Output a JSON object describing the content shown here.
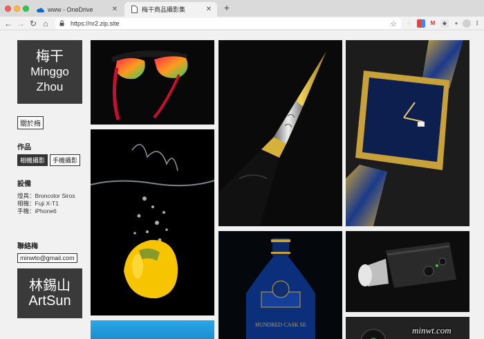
{
  "browser": {
    "tabs": [
      {
        "title": "www - OneDrive",
        "icon": "cloud-icon"
      },
      {
        "title": "梅干商品攝影集",
        "icon": "document-icon"
      }
    ],
    "url": "https://nr2.zip.site"
  },
  "sidebar": {
    "logo_line1": "梅干",
    "logo_line2": "Minggo",
    "logo_line3": "Zhou",
    "about_label": "關於梅",
    "works_title": "作品",
    "works_tabs": [
      "相機攝影",
      "手機攝影"
    ],
    "equipment_title": "設備",
    "equipment": [
      "燈具：Broncolor Siros",
      "相機：Fuji X-T1",
      "手機：iPhone6"
    ],
    "contact_title": "聯絡梅",
    "email": "minwto@gmail.com",
    "logo2_line1": "林錫山",
    "logo2_line2": "ArtSun"
  },
  "photos": {
    "bottle_label": "HUNDRED CASK SE"
  },
  "watermark": "minwt.com",
  "colors": {
    "dark_panel": "#3a3a3a",
    "page_bg": "#f1f1f1"
  }
}
